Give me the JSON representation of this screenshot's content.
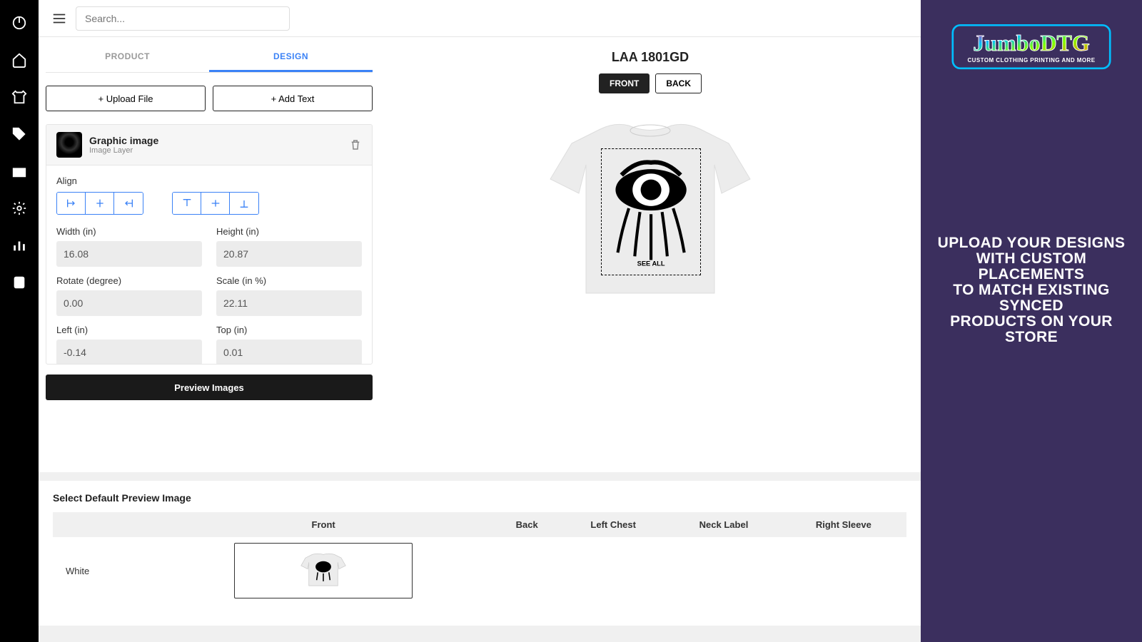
{
  "search": {
    "placeholder": "Search..."
  },
  "tabs": {
    "product": "PRODUCT",
    "design": "DESIGN"
  },
  "buttons": {
    "upload": "+ Upload File",
    "addText": "+ Add Text",
    "preview": "Preview Images"
  },
  "layer": {
    "title": "Graphic image",
    "subtitle": "Image Layer"
  },
  "controls": {
    "alignLabel": "Align",
    "widthLabel": "Width (in)",
    "width": "16.08",
    "heightLabel": "Height (in)",
    "height": "20.87",
    "rotateLabel": "Rotate (degree)",
    "rotate": "0.00",
    "scaleLabel": "Scale (in %)",
    "scale": "22.11",
    "leftLabel": "Left (in)",
    "left": "-0.14",
    "topLabel": "Top (in)",
    "top": "0.01"
  },
  "preview": {
    "title": "LAA 1801GD",
    "front": "FRONT",
    "back": "BACK"
  },
  "bottom": {
    "title": "Select Default Preview Image",
    "cols": [
      "",
      "Front",
      "Back",
      "Left Chest",
      "Neck Label",
      "Right Sleeve"
    ],
    "rowLabel": "White"
  },
  "banner": {
    "brand": "JumboDTG",
    "tagline": "CUSTOM CLOTHING PRINTING AND MORE",
    "headline": "UPLOAD YOUR DESIGNS\nWITH CUSTOM PLACEMENTS\nTO MATCH EXISTING SYNCED\nPRODUCTS ON YOUR STORE"
  }
}
